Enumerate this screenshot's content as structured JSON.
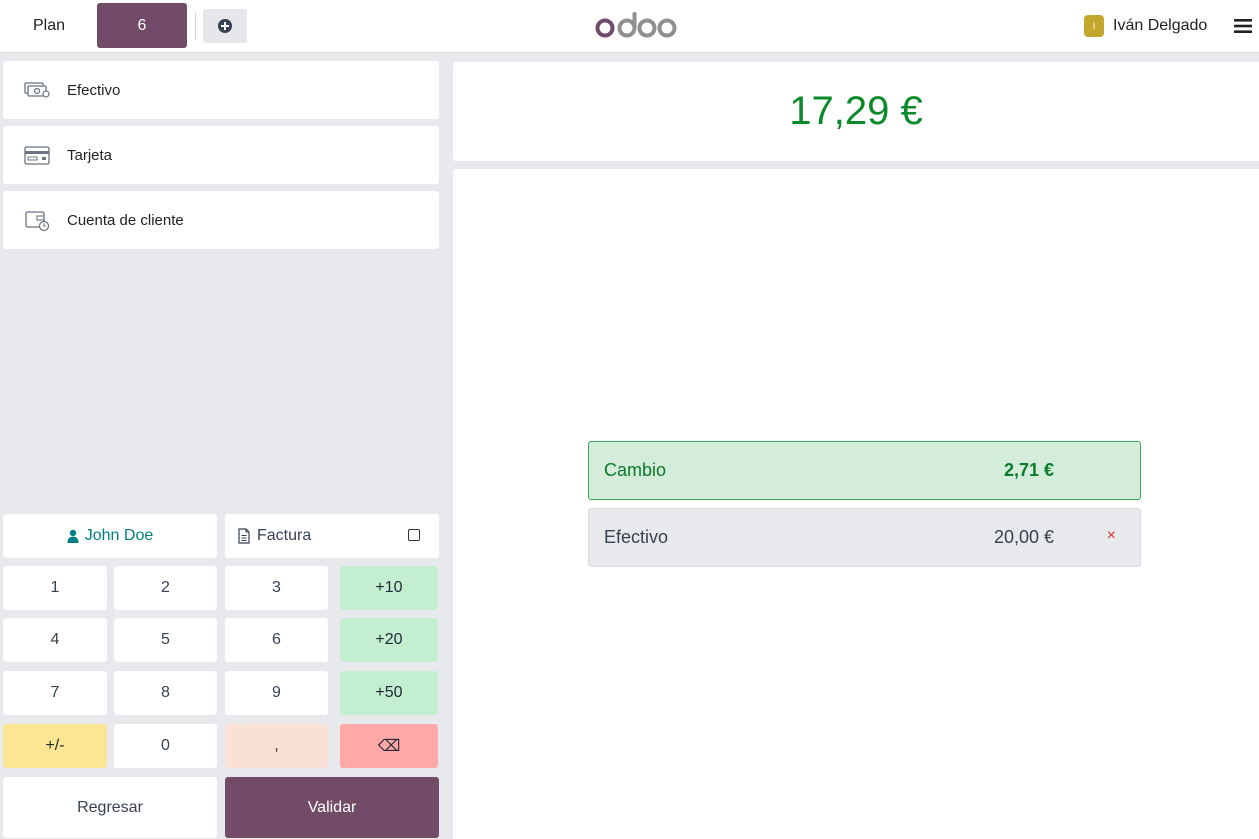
{
  "header": {
    "plan_label": "Plan",
    "table_number": "6",
    "logo_text": "odoo",
    "user_initial": "I",
    "user_name": "Iván Delgado"
  },
  "payment_methods": [
    {
      "label": "Efectivo",
      "icon": "cash-icon"
    },
    {
      "label": "Tarjeta",
      "icon": "card-icon"
    },
    {
      "label": "Cuenta de cliente",
      "icon": "customer-account-icon"
    }
  ],
  "controls": {
    "customer_name": "John Doe",
    "invoice_label": "Factura",
    "invoice_checked": false
  },
  "numpad": {
    "keys": [
      "1",
      "2",
      "3",
      "+10",
      "4",
      "5",
      "6",
      "+20",
      "7",
      "8",
      "9",
      "+50",
      "+/-",
      "0",
      ",",
      "⌫"
    ]
  },
  "actions": {
    "back_label": "Regresar",
    "validate_label": "Validar"
  },
  "summary": {
    "total": "17,29 €",
    "change_label": "Cambio",
    "change_amount": "2,71 €"
  },
  "payment_lines": [
    {
      "method": "Efectivo",
      "amount": "20,00 €",
      "remove_icon": "×"
    }
  ],
  "colors": {
    "brand": "#714b67",
    "total_green": "#0b8a2a",
    "quick_add_green": "#c3efd0",
    "sign_yellow": "#fde693",
    "decimal_peach": "#f9e1d6",
    "backspace_red": "#ffa8a8",
    "remove_red": "#d9332f"
  }
}
